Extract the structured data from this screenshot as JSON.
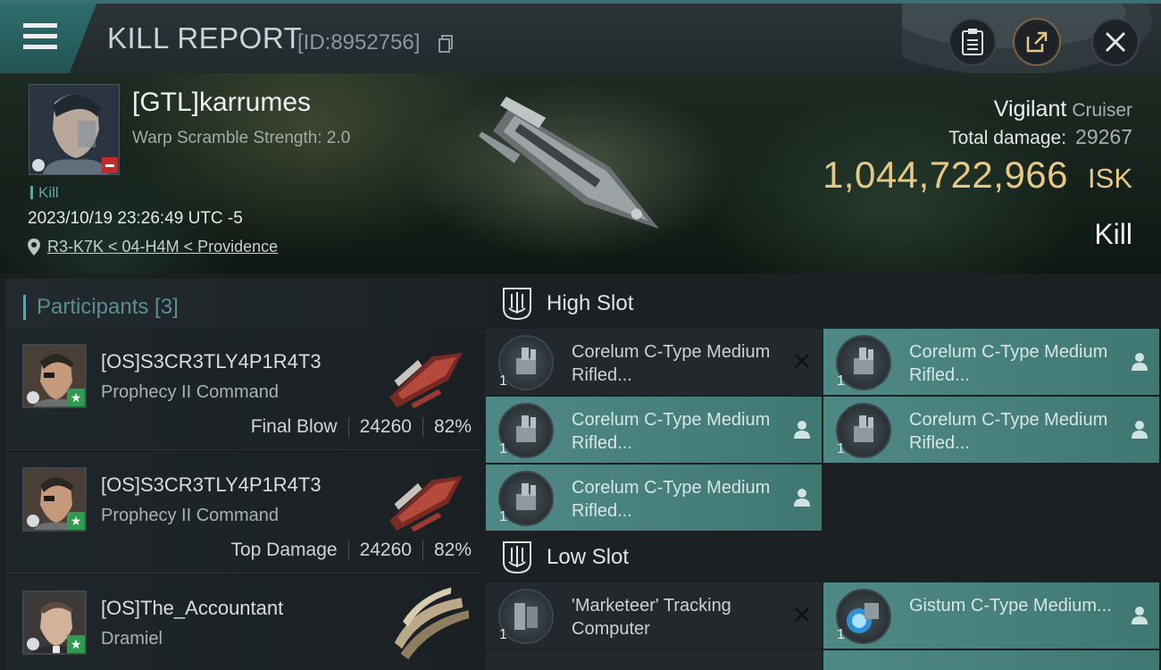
{
  "header": {
    "title": "KILL REPORT",
    "report_id": "[ID:8952756]"
  },
  "victim": {
    "name": "[GTL]karrumes",
    "warp_strength": "Warp Scramble Strength: 2.0",
    "tag": "Kill",
    "timestamp": "2023/10/19 23:26:49 UTC -5",
    "location": "R3-K7K < 04-H4M < Providence",
    "ship_name": "Vigilant",
    "ship_class": "Cruiser",
    "total_damage_label": "Total damage:",
    "total_damage": "29267",
    "isk_value": "1,044,722,966",
    "isk_unit": "ISK",
    "result": "Kill"
  },
  "participants": {
    "label": "Participants [3]",
    "items": [
      {
        "name": "[OS]S3CR3TLY4P1R4T3",
        "ship": "Prophecy II Command",
        "role": "Final Blow",
        "damage": "24260",
        "percent": "82%"
      },
      {
        "name": "[OS]S3CR3TLY4P1R4T3",
        "ship": "Prophecy II Command",
        "role": "Top Damage",
        "damage": "24260",
        "percent": "82%"
      },
      {
        "name": "[OS]The_Accountant",
        "ship": "Dramiel",
        "role": "",
        "damage": "",
        "percent": ""
      }
    ]
  },
  "high_slot": {
    "label": "High Slot",
    "modules": [
      {
        "qty": "1",
        "name": "Corelum C-Type Medium Rifled...",
        "state": "destroyed"
      },
      {
        "qty": "1",
        "name": "Corelum C-Type Medium Rifled...",
        "state": "dropped"
      },
      {
        "qty": "1",
        "name": "Corelum C-Type Medium Rifled...",
        "state": "dropped"
      },
      {
        "qty": "1",
        "name": "Corelum C-Type Medium Rifled...",
        "state": "dropped"
      },
      {
        "qty": "1",
        "name": "Corelum C-Type Medium Rifled...",
        "state": "dropped"
      }
    ]
  },
  "low_slot": {
    "label": "Low Slot",
    "modules": [
      {
        "qty": "1",
        "name": "'Marketeer' Tracking Computer",
        "state": "destroyed"
      },
      {
        "qty": "1",
        "name": "Gistum C-Type Medium...",
        "state": "dropped"
      }
    ]
  },
  "colors": {
    "accent": "#5fa3a8",
    "isk": "#e7c886",
    "dropped_bg": "#4f8985"
  }
}
